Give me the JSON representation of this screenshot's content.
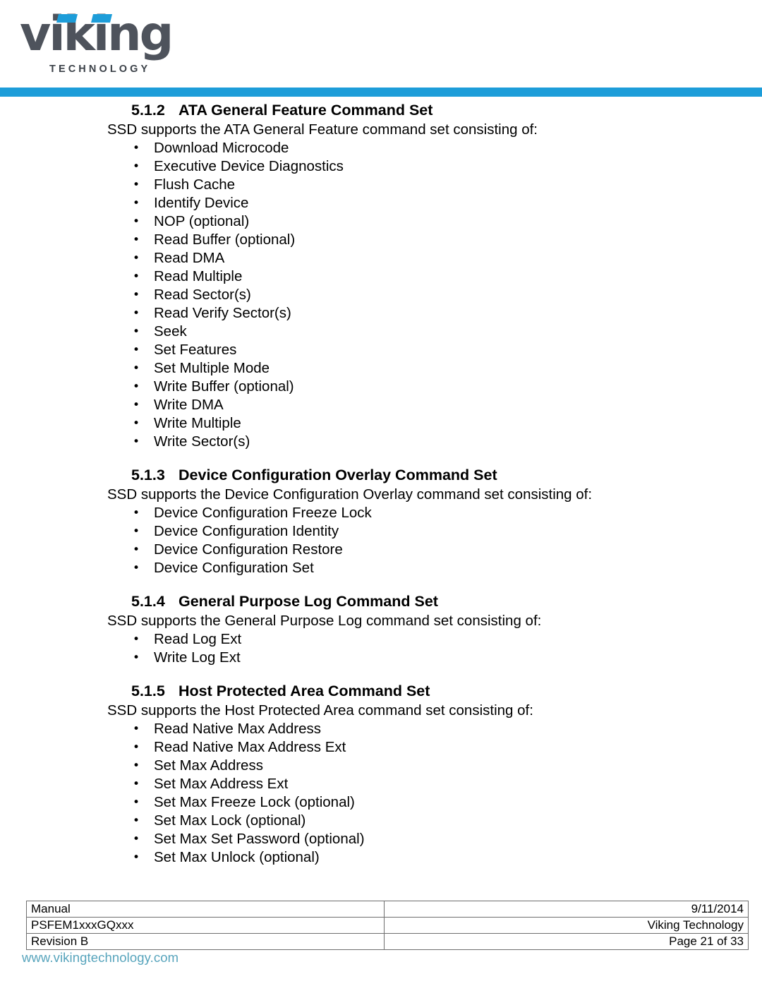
{
  "brand": {
    "logo_word": "viking",
    "logo_tagline": "TECHNOLOGY",
    "accent_color": "#1d9dd9",
    "logo_text_color": "#4e535c",
    "site_url": "www.vikingtechnology.com",
    "site_url_color": "#57a4bc"
  },
  "sections": [
    {
      "number": "5.1.2",
      "title": "ATA General Feature Command Set",
      "intro": "SSD supports the ATA General Feature command set consisting of:",
      "bullet_glyph": "•",
      "items": [
        "Download Microcode",
        "Executive Device Diagnostics",
        "Flush Cache",
        "Identify Device",
        "NOP (optional)",
        "Read Buffer (optional)",
        "Read DMA",
        "Read Multiple",
        "Read Sector(s)",
        "Read Verify Sector(s)",
        "Seek",
        "Set Features",
        "Set Multiple Mode",
        "Write Buffer (optional)",
        "Write DMA",
        "Write Multiple",
        "Write Sector(s)"
      ]
    },
    {
      "number": "5.1.3",
      "title": "Device Configuration Overlay Command Set",
      "intro": "SSD supports the Device Configuration Overlay command set consisting of:",
      "bullet_glyph": "•",
      "items": [
        "Device Configuration Freeze Lock",
        "Device Configuration Identity",
        "Device Configuration Restore",
        "Device Configuration Set"
      ]
    },
    {
      "number": "5.1.4",
      "title": "General Purpose Log Command Set",
      "intro": "SSD supports the General Purpose Log command set consisting of:",
      "bullet_glyph": "•",
      "items": [
        "Read Log Ext",
        "Write Log Ext"
      ]
    },
    {
      "number": "5.1.5",
      "title": "Host Protected Area Command Set",
      "intro": "SSD supports the Host Protected Area command set consisting of:",
      "bullet_glyph": "•",
      "items": [
        "Read Native Max Address",
        "Read Native Max Address Ext",
        "Set Max Address",
        "Set Max Address Ext",
        "Set Max Freeze Lock (optional)",
        "Set Max Lock (optional)",
        "Set Max Set Password (optional)",
        "Set Max Unlock (optional)"
      ]
    }
  ],
  "footer": {
    "rows": [
      {
        "left": "Manual",
        "right": "9/11/2014"
      },
      {
        "left": "PSFEM1xxxGQxxx",
        "right": "Viking Technology"
      },
      {
        "left": "Revision B",
        "right": "Page 21 of 33"
      }
    ]
  }
}
